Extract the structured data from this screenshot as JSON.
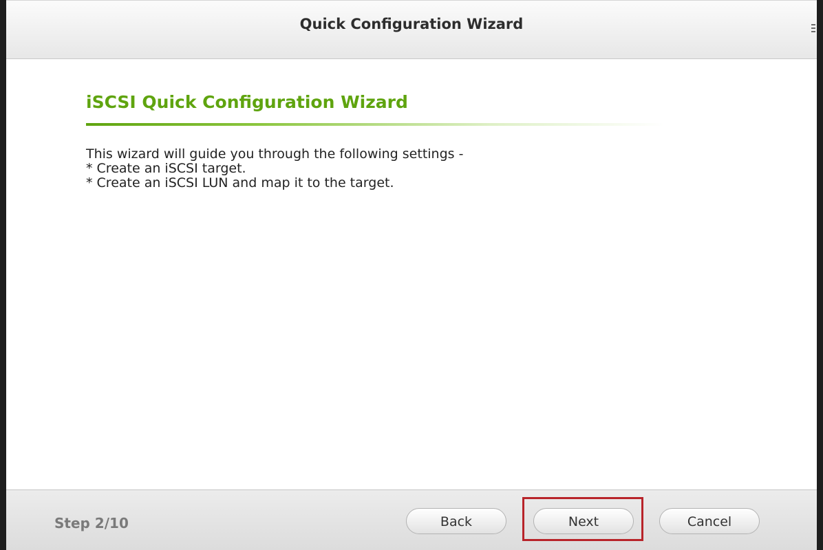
{
  "window": {
    "title": "Quick Configuration Wizard"
  },
  "content": {
    "heading": "iSCSI Quick Configuration Wizard",
    "description": [
      "This wizard will guide you through the following settings -",
      "* Create an iSCSI target.",
      "* Create an iSCSI LUN and map it to the target."
    ]
  },
  "footer": {
    "step_label": "Step 2/10",
    "back_label": "Back",
    "next_label": "Next",
    "cancel_label": "Cancel"
  },
  "colors": {
    "heading_green": "#5fa40f",
    "highlight_red": "#b8242a"
  }
}
